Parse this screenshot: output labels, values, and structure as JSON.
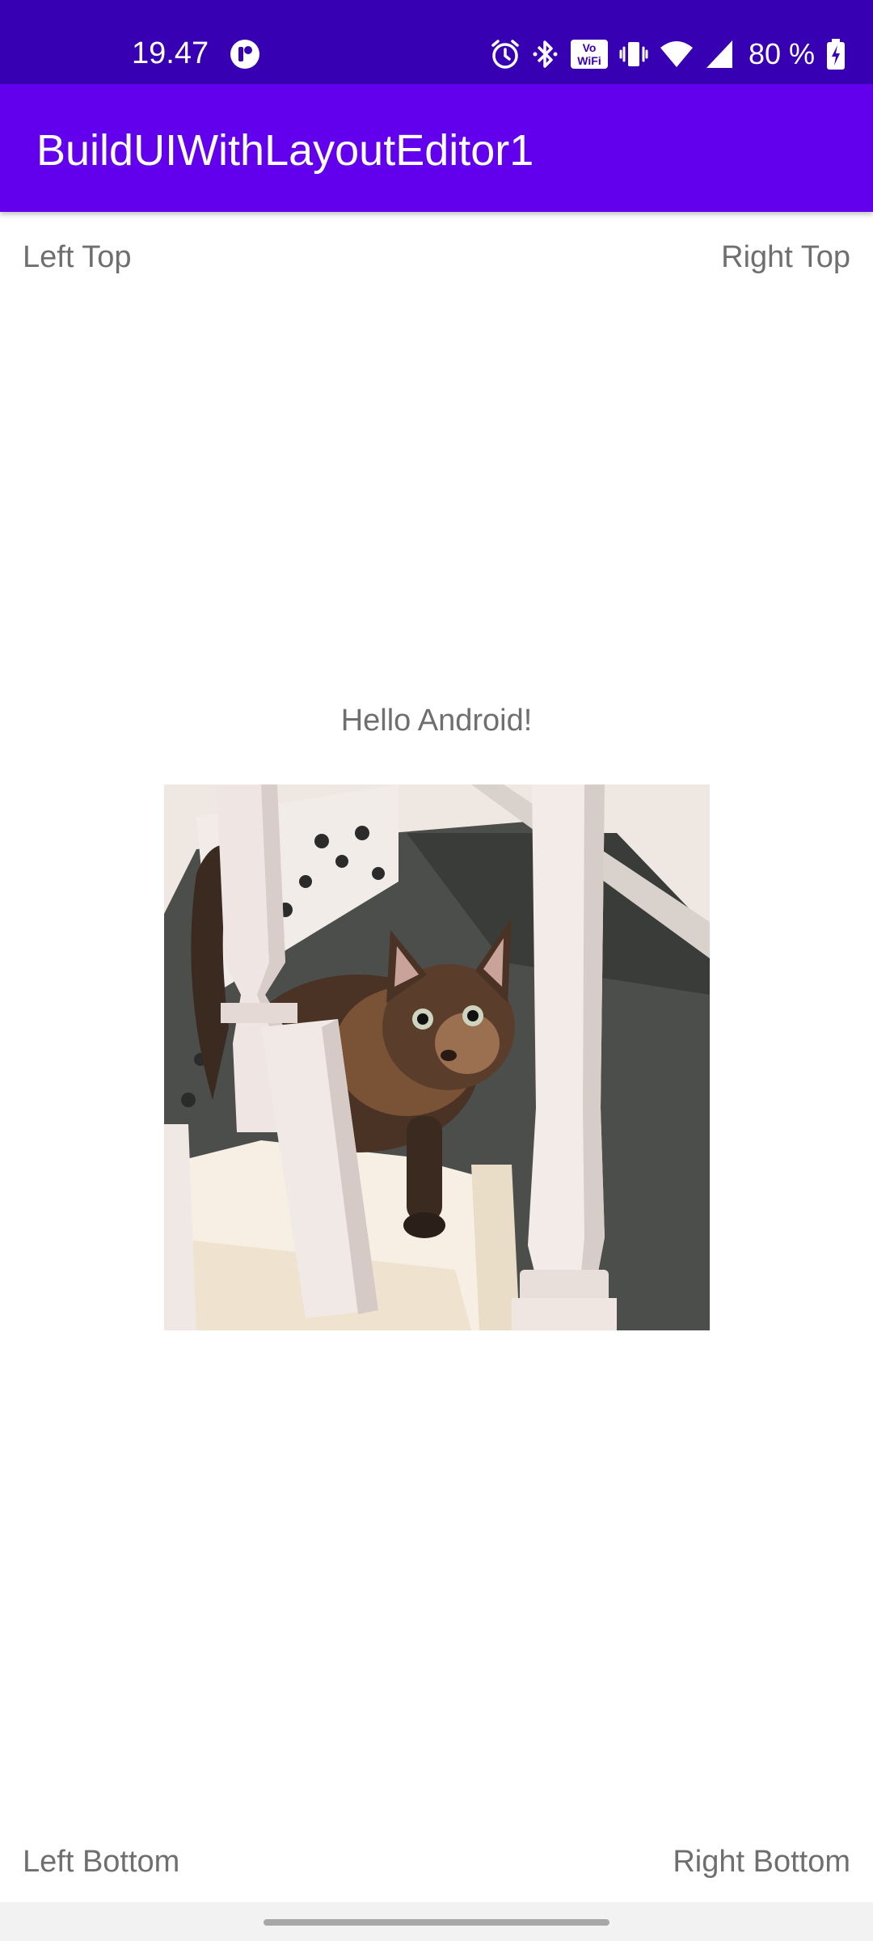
{
  "status_bar": {
    "time": "19.47",
    "battery_percent": "80 %",
    "icons": [
      "app-notification-icon",
      "alarm-icon",
      "bluetooth-icon",
      "volte-wifi-icon",
      "vibrate-icon",
      "wifi-icon",
      "cellular-signal-icon",
      "battery-charging-icon"
    ],
    "volte_text": "Vo",
    "wifi_text": "WiFi"
  },
  "app_bar": {
    "title": "BuildUIWithLayoutEditor1",
    "background": "#6200ee",
    "status_background": "#3700b3"
  },
  "labels": {
    "left_top": "Left Top",
    "right_top": "Right Top",
    "center": "Hello Android!",
    "left_bottom": "Left Bottom",
    "right_bottom": "Right Bottom"
  },
  "image": {
    "subject": "cat-photo"
  }
}
